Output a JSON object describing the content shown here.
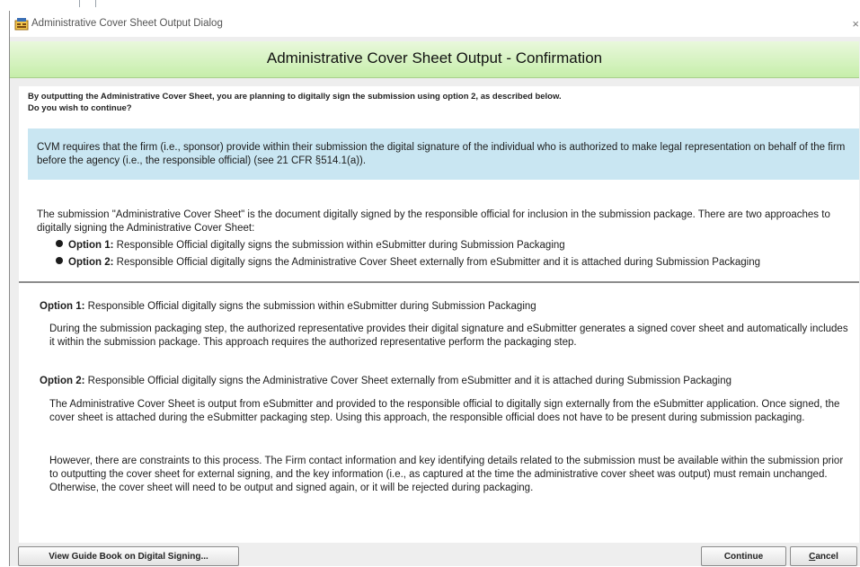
{
  "window": {
    "title": "Administrative Cover Sheet Output Dialog",
    "close_glyph": "×"
  },
  "banner": {
    "heading": "Administrative Cover Sheet Output - Confirmation"
  },
  "question": {
    "line1": "By outputting the Administrative Cover Sheet, you are planning to digitally sign the submission using option 2, as described below.",
    "line2": "Do you wish to continue?"
  },
  "note": {
    "text": "CVM requires that the firm (i.e., sponsor) provide within their submission the digital signature of the individual who is authorized to make legal representation on behalf of the firm before the agency (i.e., the responsible official) (see 21 CFR §514.1(a))."
  },
  "intro": {
    "text": "The submission \"Administrative Cover Sheet\" is the document digitally signed by the responsible official for inclusion in the submission package. There are two approaches to digitally signing the Administrative Cover Sheet:"
  },
  "bullets": [
    {
      "label": "Option 1:",
      "text": " Responsible Official digitally signs the submission within eSubmitter during Submission Packaging"
    },
    {
      "label": "Option 2:",
      "text": " Responsible Official digitally signs the Administrative Cover Sheet externally from eSubmitter and it is attached during Submission Packaging"
    }
  ],
  "option1": {
    "label": "Option 1:",
    "title": " Responsible Official digitally signs the submission within eSubmitter during Submission Packaging",
    "paragraph": "During the submission packaging step, the authorized representative provides their digital signature and eSubmitter generates a signed cover sheet and automatically includes it within the submission package. This approach requires the authorized representative perform the packaging step."
  },
  "option2": {
    "label": "Option 2:",
    "title": " Responsible Official digitally signs the Administrative Cover Sheet externally from eSubmitter and it is attached during Submission Packaging",
    "paragraph1": "The Administrative Cover Sheet is output from eSubmitter and provided to the responsible official to digitally sign externally from the eSubmitter application. Once signed, the cover sheet is attached during the eSubmitter packaging step. Using this approach, the responsible official does not have to be present during submission packaging.",
    "paragraph2": "However, there are constraints to this process. The Firm contact information and key identifying details related to the submission must be available within the submission prior to outputting the cover sheet for external signing, and the key information (i.e., as captured at the time the administrative cover sheet was output) must remain unchanged. Otherwise, the cover sheet will need to be output and signed again, or it will be rejected during packaging."
  },
  "buttons": {
    "guide": "View Guide Book on Digital Signing...",
    "continue": "Continue",
    "cancel_mnemonic": "C",
    "cancel_rest": "ancel"
  },
  "colors": {
    "banner_top": "#e9f8dc",
    "banner_bottom": "#c6eeaa",
    "note_bg": "#c9e6f2"
  }
}
